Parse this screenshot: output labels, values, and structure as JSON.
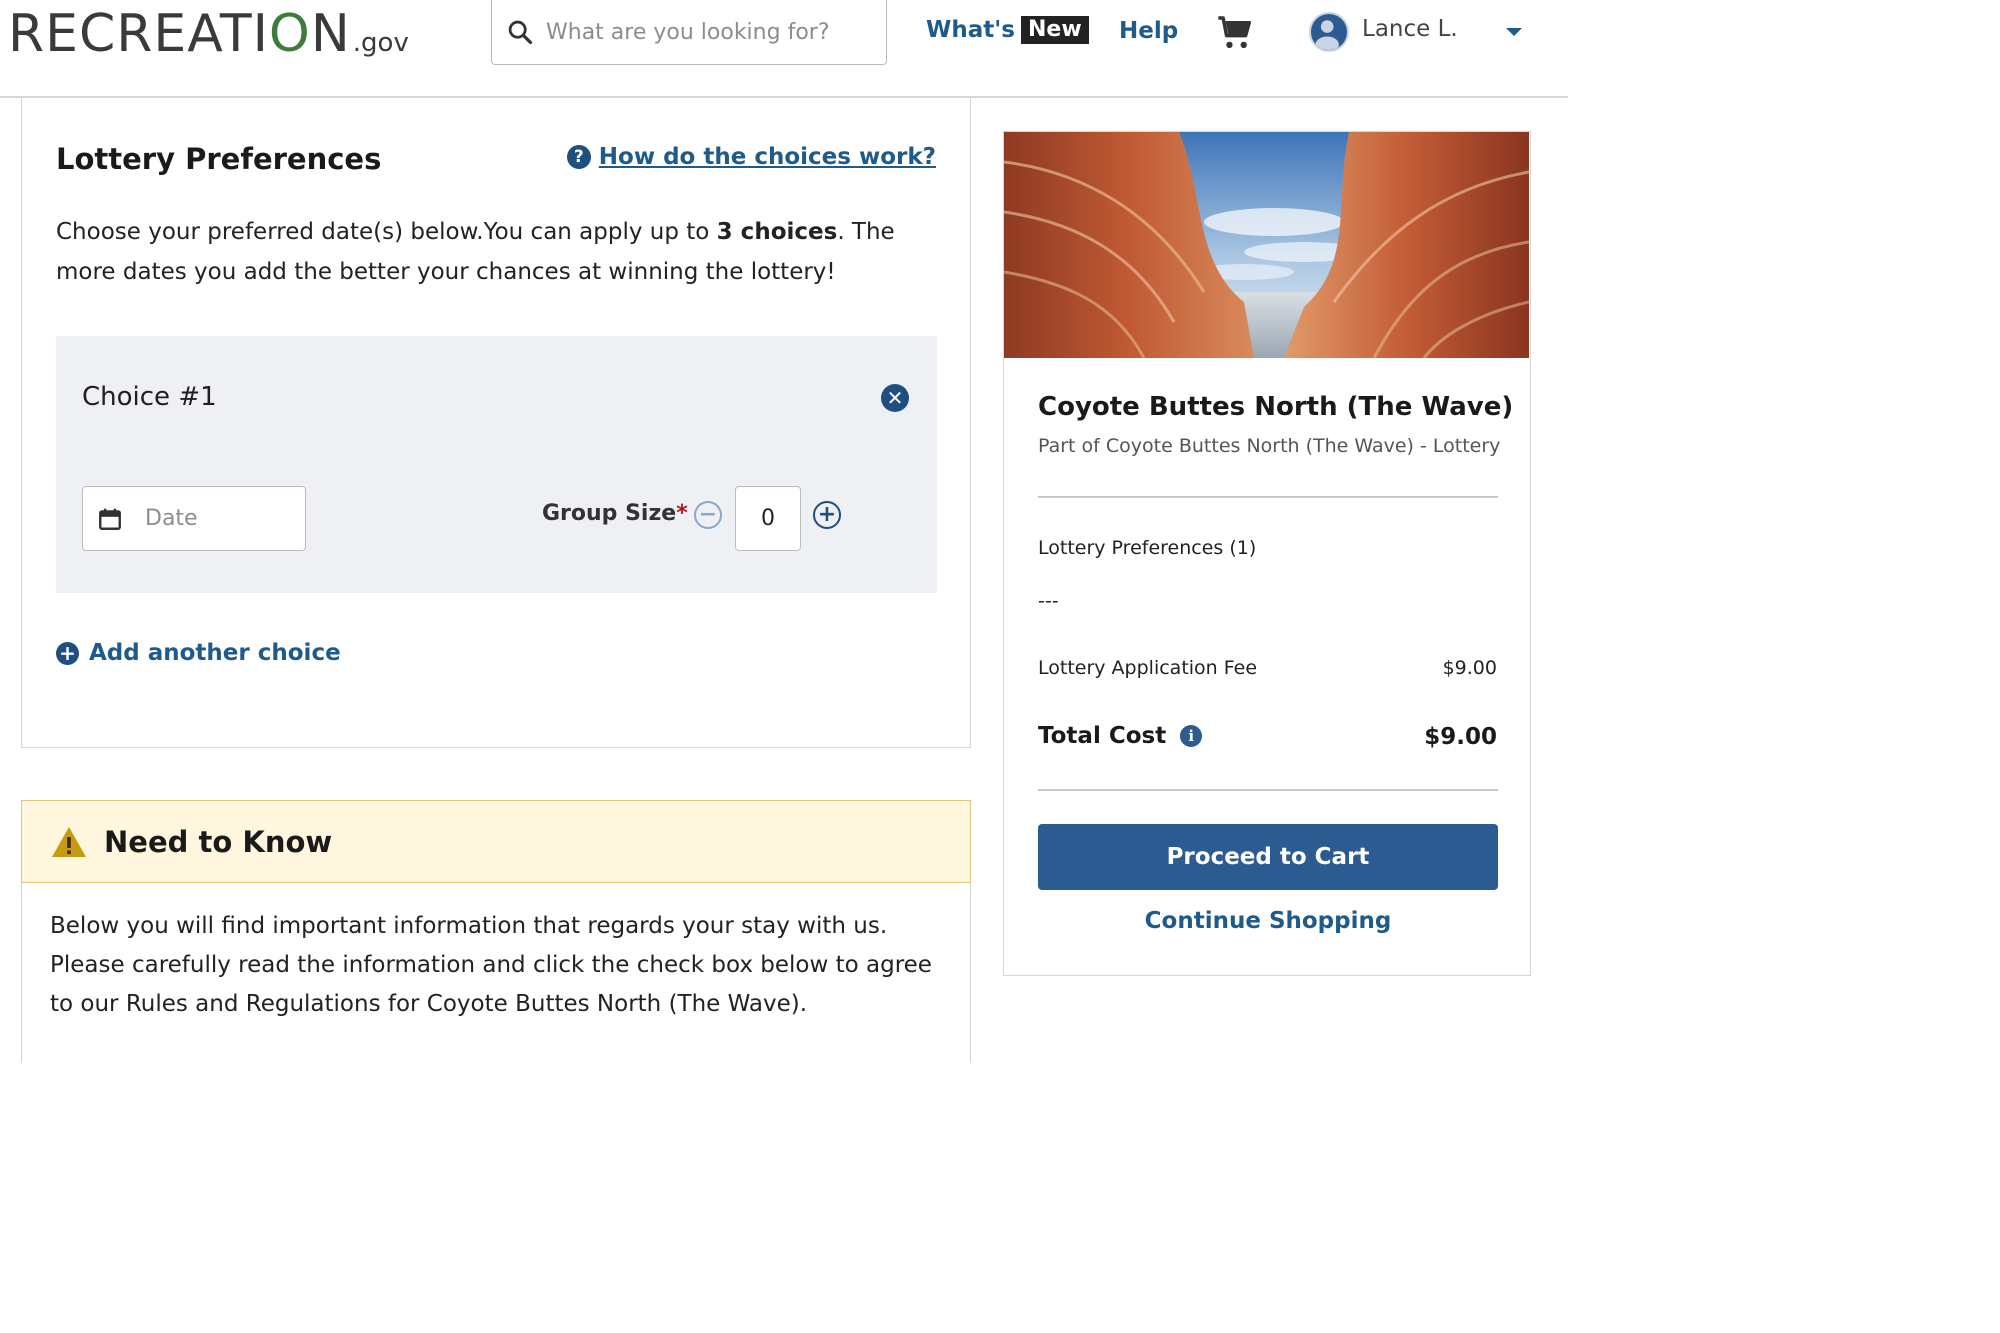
{
  "header": {
    "logo": {
      "word_part1": "RECREATI",
      "word_o": "O",
      "word_part2": "N",
      "gov": ".gov"
    },
    "search": {
      "placeholder": "What are you looking for?",
      "icon": "search-icon"
    },
    "nav": {
      "whats": "What's",
      "new_badge": "New",
      "help": "Help"
    },
    "cart": {
      "icon": "cart-icon"
    },
    "user": {
      "name": "Lance L.",
      "icon": "avatar",
      "menu_icon": "chevron-down-icon"
    }
  },
  "lottery_preferences": {
    "title": "Lottery Preferences",
    "help_link": "How do the choices work?",
    "description_part1": "Choose your preferred date(s) below.You can apply up to ",
    "description_bold": "3 choices",
    "description_part2": ". The more dates you add the better your chances at winning the lottery!",
    "choices": [
      {
        "title": "Choice #1",
        "date_placeholder": "Date",
        "group_size_label": "Group Size",
        "required_mark": "*",
        "group_size_value": "0"
      }
    ],
    "add_choice": "Add another choice"
  },
  "need_to_know": {
    "title": "Need to Know",
    "body": "Below you will find important information that regards your stay with us. Please carefully read the information and click the check box below to agree to our Rules and Regulations for Coyote Buttes North (The Wave)."
  },
  "summary": {
    "title": "Coyote Buttes North (The Wave)",
    "subtitle": "Part of Coyote Buttes North (The Wave) - Lottery",
    "preferences_label": "Lottery Preferences (1)",
    "preferences_value": "---",
    "fee_label": "Lottery Application Fee",
    "fee_value": "$9.00",
    "total_label": "Total Cost",
    "total_value": "$9.00",
    "proceed_button": "Proceed to Cart",
    "continue_link": "Continue Shopping"
  },
  "colors": {
    "brand_blue": "#1e5a8c",
    "button_blue": "#2c5b92",
    "logo_green": "#3d7c3a",
    "warning_bg": "#fff6de",
    "choice_bg": "#eef0f4"
  }
}
